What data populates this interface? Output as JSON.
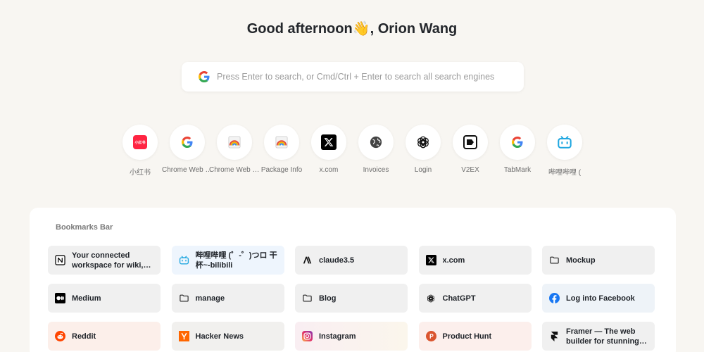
{
  "greeting": "Good afternoon👋, Orion Wang",
  "search": {
    "placeholder": "Press Enter to search, or Cmd/Ctrl + Enter to search all search engines",
    "value": ""
  },
  "shortcuts": [
    {
      "label": "小红书",
      "icon": "xiaohongshu-icon"
    },
    {
      "label": "Chrome Web Store",
      "icon": "google-icon"
    },
    {
      "label": "Chrome Web Store",
      "icon": "chrome-rainbow-icon"
    },
    {
      "label": "Package Info",
      "icon": "chrome-rainbow-icon"
    },
    {
      "label": "x.com",
      "icon": "x-icon"
    },
    {
      "label": "Invoices",
      "icon": "globe-icon"
    },
    {
      "label": "Login",
      "icon": "openai-icon"
    },
    {
      "label": "V2EX",
      "icon": "v2ex-icon"
    },
    {
      "label": "TabMark",
      "icon": "google-icon"
    },
    {
      "label": "哔哩哔哩 (",
      "icon": "bilibili-icon"
    }
  ],
  "xiaohongshu_logo_text": "小红书",
  "bookmarks": {
    "title": "Bookmarks Bar",
    "items": [
      {
        "label": "Your connected workspace for wiki, docs & projects | Notion",
        "icon": "notion-icon"
      },
      {
        "label": "哔哩哔哩 (゜-゜)つロ 干杯~-bilibili",
        "icon": "bilibili-icon"
      },
      {
        "label": "claude3.5",
        "icon": "anthropic-icon"
      },
      {
        "label": "x.com",
        "icon": "x-icon"
      },
      {
        "label": "Mockup",
        "icon": "folder-icon"
      },
      {
        "label": "Medium",
        "icon": "medium-icon"
      },
      {
        "label": "manage",
        "icon": "folder-icon"
      },
      {
        "label": "Blog",
        "icon": "folder-icon"
      },
      {
        "label": "ChatGPT",
        "icon": "openai-icon"
      },
      {
        "label": "Log into Facebook",
        "icon": "facebook-icon"
      },
      {
        "label": "Reddit",
        "icon": "reddit-icon"
      },
      {
        "label": "Hacker News",
        "icon": "hackernews-icon"
      },
      {
        "label": "Instagram",
        "icon": "instagram-icon"
      },
      {
        "label": "Product Hunt",
        "icon": "producthunt-icon"
      },
      {
        "label": "Framer — The web builder for stunning sites",
        "icon": "framer-icon"
      }
    ]
  }
}
